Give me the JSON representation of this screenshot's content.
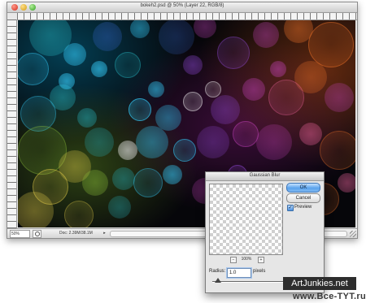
{
  "window": {
    "title": "bokeh2.psd @ 50% (Layer 22, RGB/8)"
  },
  "statusbar": {
    "zoom": "50%",
    "doc_info": "Doc: 2.39M/38.1M",
    "arrow": "▸"
  },
  "dialog": {
    "title": "Gaussian Blur",
    "ok_label": "OK",
    "cancel_label": "Cancel",
    "preview_label": "Preview",
    "preview_checked": "✓",
    "preview_zoom": "100%",
    "zoom_out": "−",
    "zoom_in": "+",
    "radius_label": "Radius:",
    "radius_value": "1.0",
    "radius_unit": "pixels",
    "radius_slider_fraction": 0.05
  },
  "icons": {
    "close": "close-icon",
    "minimize": "minimize-icon",
    "zoom": "zoom-icon",
    "status": "status-menu-icon",
    "grip": "resize-grip-icon"
  },
  "watermarks": {
    "site1": "ArtJunkies.net",
    "site2": "www.Bce-TYT.ru"
  },
  "colors": {
    "cyan": "#35d0ff",
    "teal": "#26b8c4",
    "blue": "#3a6fe0",
    "magenta": "#d046c8",
    "violet": "#9a4ee8",
    "orange": "#ff7a2a",
    "yellow": "#e8d04a",
    "green": "#8ec23a",
    "pink": "#ff6aa8",
    "white": "#ffffff"
  }
}
